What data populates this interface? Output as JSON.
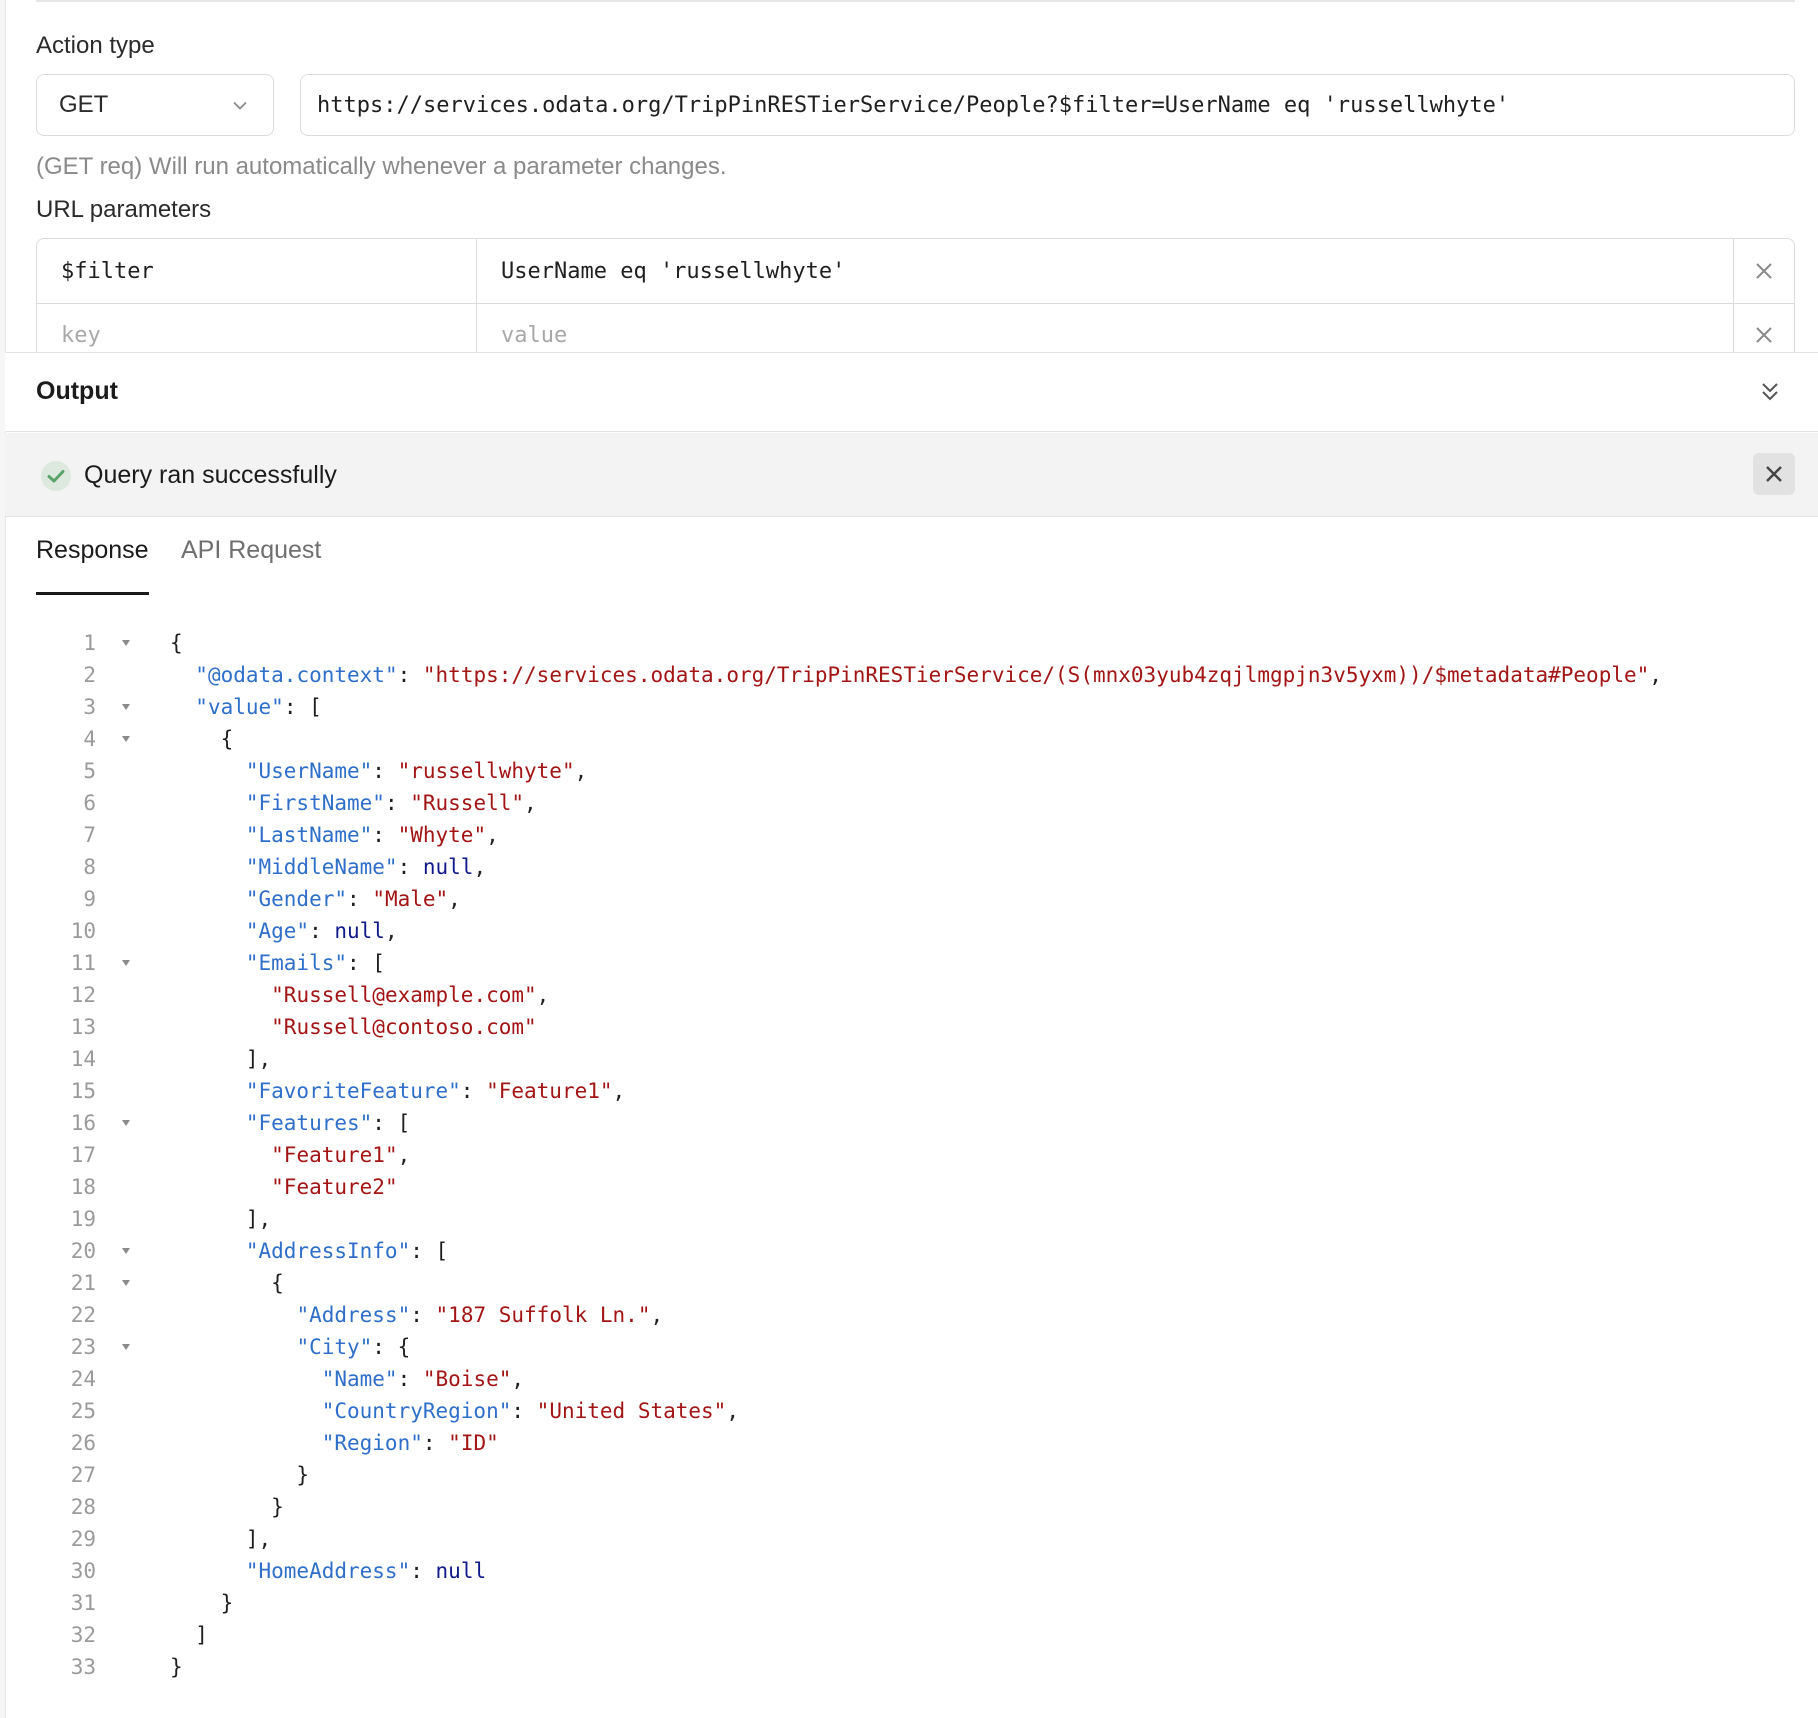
{
  "action": {
    "label": "Action type",
    "method": "GET",
    "url": "https://services.odata.org/TripPinRESTierService/People?$filter=UserName eq 'russellwhyte'",
    "helper": "(GET req) Will run automatically whenever a parameter changes."
  },
  "params": {
    "label": "URL parameters",
    "rows": [
      {
        "key": "$filter",
        "value": "UserName eq 'russellwhyte'"
      }
    ],
    "key_placeholder": "key",
    "value_placeholder": "value"
  },
  "output": {
    "title": "Output",
    "status": "Query ran successfully"
  },
  "tabs": [
    "Response",
    "API Request"
  ],
  "colors": {
    "json_key": "#2f6fc9",
    "json_string": "#a31515",
    "json_null": "#0f1a8a",
    "success": "#5aa36a"
  },
  "response": {
    "lines": [
      {
        "n": "1",
        "fold": true,
        "t": [
          [
            "p",
            "{"
          ]
        ]
      },
      {
        "n": "2",
        "fold": false,
        "t": [
          [
            "p",
            "  "
          ],
          [
            "k",
            "\"@odata.context\""
          ],
          [
            "p",
            ": "
          ],
          [
            "s",
            "\"https://services.odata.org/TripPinRESTierService/(S(mnx03yub4zqjlmgpjn3v5yxm))/$metadata#People\""
          ],
          [
            "p",
            ","
          ]
        ]
      },
      {
        "n": "3",
        "fold": true,
        "t": [
          [
            "p",
            "  "
          ],
          [
            "k",
            "\"value\""
          ],
          [
            "p",
            ": ["
          ]
        ]
      },
      {
        "n": "4",
        "fold": true,
        "t": [
          [
            "p",
            "    {"
          ]
        ]
      },
      {
        "n": "5",
        "fold": false,
        "t": [
          [
            "p",
            "      "
          ],
          [
            "k",
            "\"UserName\""
          ],
          [
            "p",
            ": "
          ],
          [
            "s",
            "\"russellwhyte\""
          ],
          [
            "p",
            ","
          ]
        ]
      },
      {
        "n": "6",
        "fold": false,
        "t": [
          [
            "p",
            "      "
          ],
          [
            "k",
            "\"FirstName\""
          ],
          [
            "p",
            ": "
          ],
          [
            "s",
            "\"Russell\""
          ],
          [
            "p",
            ","
          ]
        ]
      },
      {
        "n": "7",
        "fold": false,
        "t": [
          [
            "p",
            "      "
          ],
          [
            "k",
            "\"LastName\""
          ],
          [
            "p",
            ": "
          ],
          [
            "s",
            "\"Whyte\""
          ],
          [
            "p",
            ","
          ]
        ]
      },
      {
        "n": "8",
        "fold": false,
        "t": [
          [
            "p",
            "      "
          ],
          [
            "k",
            "\"MiddleName\""
          ],
          [
            "p",
            ": "
          ],
          [
            "n",
            "null"
          ],
          [
            "p",
            ","
          ]
        ]
      },
      {
        "n": "9",
        "fold": false,
        "t": [
          [
            "p",
            "      "
          ],
          [
            "k",
            "\"Gender\""
          ],
          [
            "p",
            ": "
          ],
          [
            "s",
            "\"Male\""
          ],
          [
            "p",
            ","
          ]
        ]
      },
      {
        "n": "10",
        "fold": false,
        "t": [
          [
            "p",
            "      "
          ],
          [
            "k",
            "\"Age\""
          ],
          [
            "p",
            ": "
          ],
          [
            "n",
            "null"
          ],
          [
            "p",
            ","
          ]
        ]
      },
      {
        "n": "11",
        "fold": true,
        "t": [
          [
            "p",
            "      "
          ],
          [
            "k",
            "\"Emails\""
          ],
          [
            "p",
            ": ["
          ]
        ]
      },
      {
        "n": "12",
        "fold": false,
        "t": [
          [
            "p",
            "        "
          ],
          [
            "s",
            "\"Russell@example.com\""
          ],
          [
            "p",
            ","
          ]
        ]
      },
      {
        "n": "13",
        "fold": false,
        "t": [
          [
            "p",
            "        "
          ],
          [
            "s",
            "\"Russell@contoso.com\""
          ]
        ]
      },
      {
        "n": "14",
        "fold": false,
        "t": [
          [
            "p",
            "      ],"
          ]
        ]
      },
      {
        "n": "15",
        "fold": false,
        "t": [
          [
            "p",
            "      "
          ],
          [
            "k",
            "\"FavoriteFeature\""
          ],
          [
            "p",
            ": "
          ],
          [
            "s",
            "\"Feature1\""
          ],
          [
            "p",
            ","
          ]
        ]
      },
      {
        "n": "16",
        "fold": true,
        "t": [
          [
            "p",
            "      "
          ],
          [
            "k",
            "\"Features\""
          ],
          [
            "p",
            ": ["
          ]
        ]
      },
      {
        "n": "17",
        "fold": false,
        "t": [
          [
            "p",
            "        "
          ],
          [
            "s",
            "\"Feature1\""
          ],
          [
            "p",
            ","
          ]
        ]
      },
      {
        "n": "18",
        "fold": false,
        "t": [
          [
            "p",
            "        "
          ],
          [
            "s",
            "\"Feature2\""
          ]
        ]
      },
      {
        "n": "19",
        "fold": false,
        "t": [
          [
            "p",
            "      ],"
          ]
        ]
      },
      {
        "n": "20",
        "fold": true,
        "t": [
          [
            "p",
            "      "
          ],
          [
            "k",
            "\"AddressInfo\""
          ],
          [
            "p",
            ": ["
          ]
        ]
      },
      {
        "n": "21",
        "fold": true,
        "t": [
          [
            "p",
            "        {"
          ]
        ]
      },
      {
        "n": "22",
        "fold": false,
        "t": [
          [
            "p",
            "          "
          ],
          [
            "k",
            "\"Address\""
          ],
          [
            "p",
            ": "
          ],
          [
            "s",
            "\"187 Suffolk Ln.\""
          ],
          [
            "p",
            ","
          ]
        ]
      },
      {
        "n": "23",
        "fold": true,
        "t": [
          [
            "p",
            "          "
          ],
          [
            "k",
            "\"City\""
          ],
          [
            "p",
            ": {"
          ]
        ]
      },
      {
        "n": "24",
        "fold": false,
        "t": [
          [
            "p",
            "            "
          ],
          [
            "k",
            "\"Name\""
          ],
          [
            "p",
            ": "
          ],
          [
            "s",
            "\"Boise\""
          ],
          [
            "p",
            ","
          ]
        ]
      },
      {
        "n": "25",
        "fold": false,
        "t": [
          [
            "p",
            "            "
          ],
          [
            "k",
            "\"CountryRegion\""
          ],
          [
            "p",
            ": "
          ],
          [
            "s",
            "\"United States\""
          ],
          [
            "p",
            ","
          ]
        ]
      },
      {
        "n": "26",
        "fold": false,
        "t": [
          [
            "p",
            "            "
          ],
          [
            "k",
            "\"Region\""
          ],
          [
            "p",
            ": "
          ],
          [
            "s",
            "\"ID\""
          ]
        ]
      },
      {
        "n": "27",
        "fold": false,
        "t": [
          [
            "p",
            "          }"
          ]
        ]
      },
      {
        "n": "28",
        "fold": false,
        "t": [
          [
            "p",
            "        }"
          ]
        ]
      },
      {
        "n": "29",
        "fold": false,
        "t": [
          [
            "p",
            "      ],"
          ]
        ]
      },
      {
        "n": "30",
        "fold": false,
        "t": [
          [
            "p",
            "      "
          ],
          [
            "k",
            "\"HomeAddress\""
          ],
          [
            "p",
            ": "
          ],
          [
            "n",
            "null"
          ]
        ]
      },
      {
        "n": "31",
        "fold": false,
        "t": [
          [
            "p",
            "    }"
          ]
        ]
      },
      {
        "n": "32",
        "fold": false,
        "t": [
          [
            "p",
            "  ]"
          ]
        ]
      },
      {
        "n": "33",
        "fold": false,
        "t": [
          [
            "p",
            "}"
          ]
        ]
      }
    ]
  }
}
